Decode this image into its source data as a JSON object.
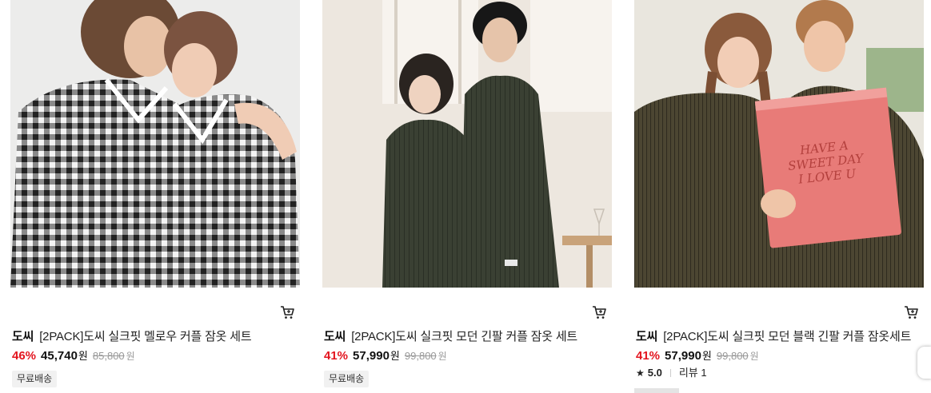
{
  "products": [
    {
      "brand": "도씨",
      "name": "[2PACK]도씨 실크핏 멜로우 커플 잠옷 세트",
      "discount": "46%",
      "price": "45,740",
      "currency": "원",
      "original_price": "85,800",
      "original_currency": "원",
      "badge": "무료배송",
      "image": "couple-gingham-pajamas",
      "cart_icon": "cart-icon"
    },
    {
      "brand": "도씨",
      "name": "[2PACK]도씨 실크핏 모던 긴팔 커플 잠옷 세트",
      "discount": "41%",
      "price": "57,990",
      "currency": "원",
      "original_price": "99,800",
      "original_currency": "원",
      "badge": "무료배송",
      "image": "couple-dark-green-pajamas",
      "cart_icon": "cart-icon"
    },
    {
      "brand": "도씨",
      "name": "[2PACK]도씨 실크핏 모던 블랙 긴팔 커플 잠옷세트",
      "discount": "41%",
      "price": "57,990",
      "currency": "원",
      "original_price": "99,800",
      "original_currency": "원",
      "rating": "5.0",
      "review_label": "리뷰 1",
      "image": "couple-pink-gift-box",
      "cart_icon": "cart-icon",
      "gift_box_text": "HAVE A SWEET DAY I LOVE U"
    }
  ],
  "colors": {
    "discount": "#e3141e",
    "badge_bg": "#f1f1f1",
    "muted": "#999999"
  }
}
